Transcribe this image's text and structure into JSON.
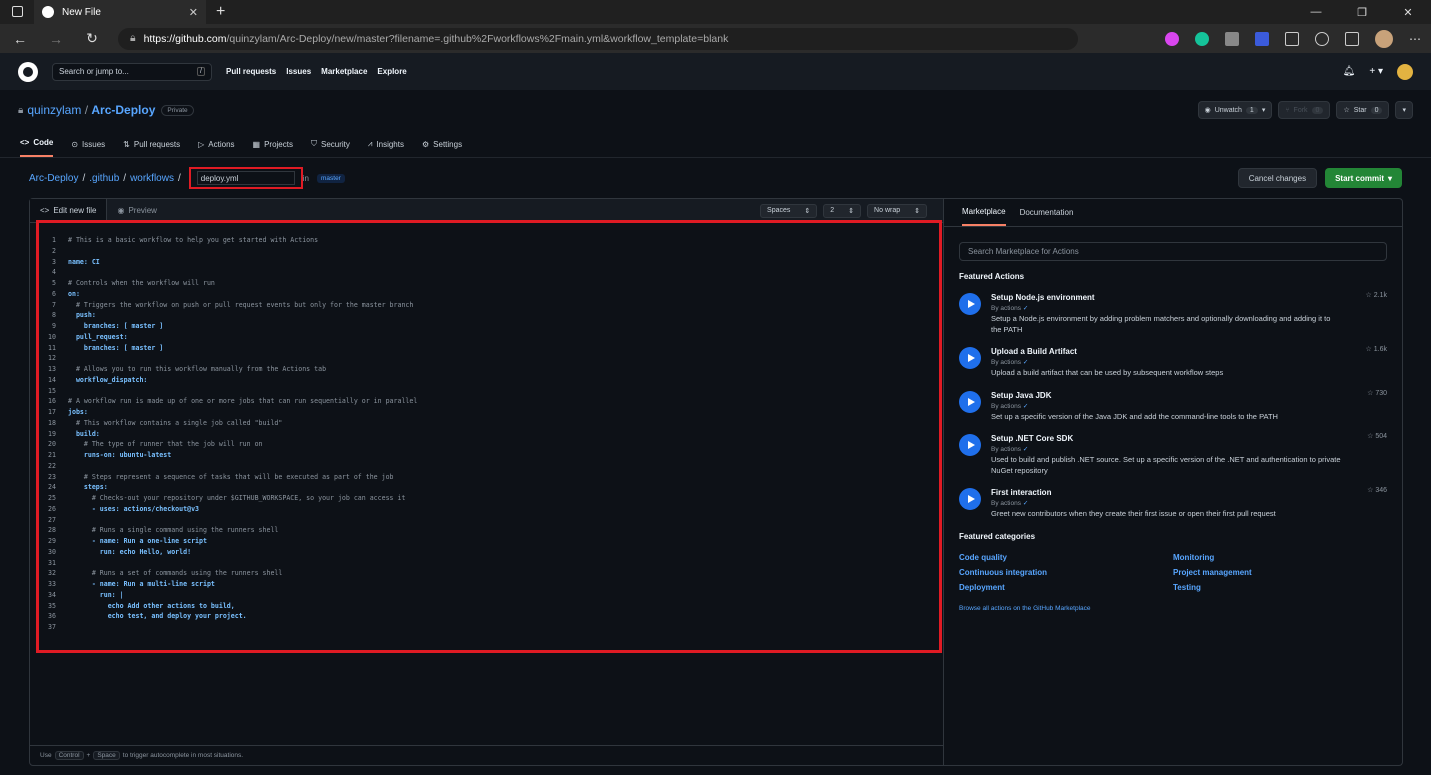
{
  "browser": {
    "tab_title": "New File",
    "url_host": "https://github.com",
    "url_path": "/quinzylam/Arc-Deploy/new/master?filename=.github%2Fworkflows%2Fmain.yml&workflow_template=blank"
  },
  "header": {
    "search_placeholder": "Search or jump to...",
    "search_key": "/",
    "nav": [
      "Pull requests",
      "Issues",
      "Marketplace",
      "Explore"
    ]
  },
  "repo": {
    "owner": "quinzylam",
    "sep": " / ",
    "name": "Arc-Deploy",
    "visibility": "Private",
    "unwatch_label": "Unwatch",
    "unwatch_count": "1",
    "fork_label": "Fork",
    "fork_count": "0",
    "star_label": "Star",
    "star_count": "0"
  },
  "reponav": [
    "Code",
    "Issues",
    "Pull requests",
    "Actions",
    "Projects",
    "Security",
    "Insights",
    "Settings"
  ],
  "path": {
    "root": "Arc-Deploy",
    "dir1": ".github",
    "dir2": "workflows",
    "filename": "deploy.yml",
    "in_label": "in",
    "branch": "master",
    "cancel": "Cancel changes",
    "commit": "Start commit"
  },
  "editor": {
    "tab_edit": "Edit new file",
    "tab_preview": "Preview",
    "indent_mode": "Spaces",
    "indent_size": "2",
    "wrap": "No wrap",
    "footer_use": "Use",
    "footer_ctrl": "Control",
    "footer_plus": "+",
    "footer_space": "Space",
    "footer_rest": "to trigger autocomplete in most situations."
  },
  "code_lines": [
    "# This is a basic workflow to help you get started with Actions",
    "",
    "name: CI",
    "",
    "# Controls when the workflow will run",
    "on:",
    "  # Triggers the workflow on push or pull request events but only for the master branch",
    "  push:",
    "    branches: [ master ]",
    "  pull_request:",
    "    branches: [ master ]",
    "",
    "  # Allows you to run this workflow manually from the Actions tab",
    "  workflow_dispatch:",
    "",
    "# A workflow run is made up of one or more jobs that can run sequentially or in parallel",
    "jobs:",
    "  # This workflow contains a single job called \"build\"",
    "  build:",
    "    # The type of runner that the job will run on",
    "    runs-on: ubuntu-latest",
    "",
    "    # Steps represent a sequence of tasks that will be executed as part of the job",
    "    steps:",
    "      # Checks-out your repository under $GITHUB_WORKSPACE, so your job can access it",
    "      - uses: actions/checkout@v3",
    "",
    "      # Runs a single command using the runners shell",
    "      - name: Run a one-line script",
    "        run: echo Hello, world!",
    "",
    "      # Runs a set of commands using the runners shell",
    "      - name: Run a multi-line script",
    "        run: |",
    "          echo Add other actions to build,",
    "          echo test, and deploy your project.",
    ""
  ],
  "sidebar": {
    "tab_marketplace": "Marketplace",
    "tab_docs": "Documentation",
    "search_placeholder": "Search Marketplace for Actions",
    "featured_actions_title": "Featured Actions",
    "actions": [
      {
        "name": "Setup Node.js environment",
        "by": "By actions",
        "stars": "2.1k",
        "desc": "Setup a Node.js environment by adding problem matchers and optionally downloading and adding it to the PATH"
      },
      {
        "name": "Upload a Build Artifact",
        "by": "By actions",
        "stars": "1.6k",
        "desc": "Upload a build artifact that can be used by subsequent workflow steps"
      },
      {
        "name": "Setup Java JDK",
        "by": "By actions",
        "stars": "730",
        "desc": "Set up a specific version of the Java JDK and add the command-line tools to the PATH"
      },
      {
        "name": "Setup .NET Core SDK",
        "by": "By actions",
        "stars": "504",
        "desc": "Used to build and publish .NET source. Set up a specific version of the .NET and authentication to private NuGet repository"
      },
      {
        "name": "First interaction",
        "by": "By actions",
        "stars": "346",
        "desc": "Greet new contributors when they create their first issue or open their first pull request"
      }
    ],
    "featured_categories_title": "Featured categories",
    "categories": [
      "Code quality",
      "Monitoring",
      "Continuous integration",
      "Project management",
      "Deployment",
      "Testing"
    ],
    "browse": "Browse all actions on the GitHub Marketplace"
  },
  "colors": {
    "highlight": "#e01b24",
    "accent": "#58a6ff",
    "commit": "#238636"
  }
}
